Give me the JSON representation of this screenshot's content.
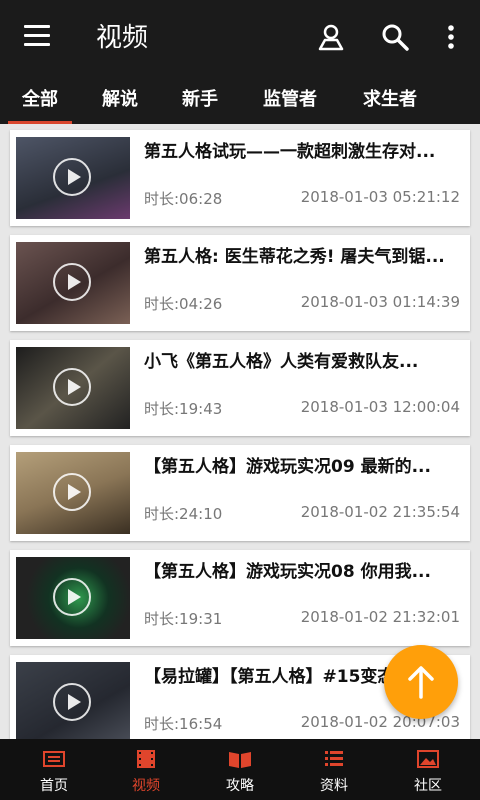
{
  "header": {
    "title": "视频",
    "icons": [
      "menu-icon",
      "user-icon",
      "search-icon",
      "more-vertical-icon"
    ]
  },
  "tabs": [
    {
      "label": "全部",
      "active": true
    },
    {
      "label": "解说",
      "active": false
    },
    {
      "label": "新手",
      "active": false
    },
    {
      "label": "监管者",
      "active": false
    },
    {
      "label": "求生者",
      "active": false
    }
  ],
  "videos": [
    {
      "title": "第五人格试玩——一款超刺激生存对...",
      "duration": "时长:06:28",
      "date": "2018-01-03 05:21:12"
    },
    {
      "title": "第五人格: 医生蒂花之秀! 屠夫气到锯...",
      "duration": "时长:04:26",
      "date": "2018-01-03 01:14:39"
    },
    {
      "title": "小飞《第五人格》人类有爱救队友...",
      "duration": "时长:19:43",
      "date": "2018-01-03 12:00:04"
    },
    {
      "title": "【第五人格】游戏玩实况09 最新的...",
      "duration": "时长:24:10",
      "date": "2018-01-02 21:35:54"
    },
    {
      "title": "【第五人格】游戏玩实况08 你用我...",
      "duration": "时长:19:31",
      "date": "2018-01-02 21:32:01"
    },
    {
      "title": "【易拉罐】【第五人格】#15变态...",
      "duration": "时长:16:54",
      "date": "2018-01-02 20:07:03"
    }
  ],
  "bottom_nav": [
    {
      "label": "首页",
      "icon": "home-icon",
      "active": false
    },
    {
      "label": "视频",
      "icon": "film-icon",
      "active": true
    },
    {
      "label": "攻略",
      "icon": "book-icon",
      "active": false
    },
    {
      "label": "资料",
      "icon": "list-icon",
      "active": false
    },
    {
      "label": "社区",
      "icon": "image-icon",
      "active": false
    }
  ],
  "colors": {
    "accent": "#e0452c",
    "fab": "#ff9f0a",
    "bar": "#1b1b1b"
  }
}
